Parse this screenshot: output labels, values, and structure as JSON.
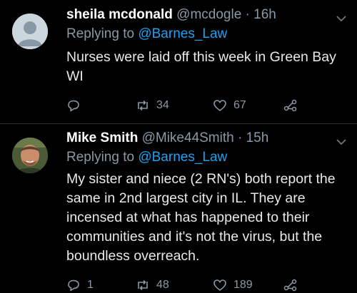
{
  "tweets": [
    {
      "name": "sheila mcdonald",
      "handle_time": "@mcdogle · 16h",
      "replying_prefix": "Replying to",
      "replying_to": "@Barnes_Law",
      "text": "Nurses were laid off this week in Green Bay WI",
      "replies": "",
      "retweets": "34",
      "likes": "67"
    },
    {
      "name": "Mike Smith",
      "handle_time": "@Mike44Smith · 15h",
      "replying_prefix": "Replying to",
      "replying_to": "@Barnes_Law",
      "text": "My sister and niece (2 RN's) both report the same in 2nd largest city in IL.  They are incensed at what has happened to their communities and it's not the virus, but the boundless overreach.",
      "replies": "1",
      "retweets": "48",
      "likes": "189"
    }
  ],
  "icons": [
    "default-avatar-icon",
    "profile-photo",
    "chevron-down-icon",
    "reply-icon",
    "retweet-icon",
    "like-icon",
    "share-icon"
  ],
  "colors": {
    "background": "#000000",
    "link": "#1da1f2",
    "muted": "#8b98a5",
    "text": "#e7e9ea"
  }
}
